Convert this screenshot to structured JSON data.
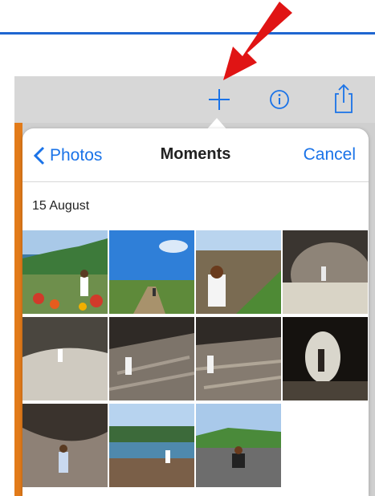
{
  "toolbar": {
    "icons": [
      "plus-icon",
      "info-icon",
      "share-icon"
    ]
  },
  "popover": {
    "back_label": "Photos",
    "title": "Moments",
    "cancel_label": "Cancel",
    "section_date": "15 August"
  },
  "colors": {
    "accent": "#1a73e8",
    "arrow": "#e01414",
    "sidebar_strip": "#e27b1a",
    "top_line": "#1f66d0"
  },
  "photos": [
    {
      "name": "photo-coast-flowers"
    },
    {
      "name": "photo-sky-path"
    },
    {
      "name": "photo-child-rocks"
    },
    {
      "name": "photo-cave-mouth"
    },
    {
      "name": "photo-cave-beach"
    },
    {
      "name": "photo-rock-ledges"
    },
    {
      "name": "photo-rock-ledges-2"
    },
    {
      "name": "photo-tunnel-light"
    },
    {
      "name": "photo-rock-overhang"
    },
    {
      "name": "photo-bay-rocks"
    },
    {
      "name": "photo-car-park"
    }
  ]
}
